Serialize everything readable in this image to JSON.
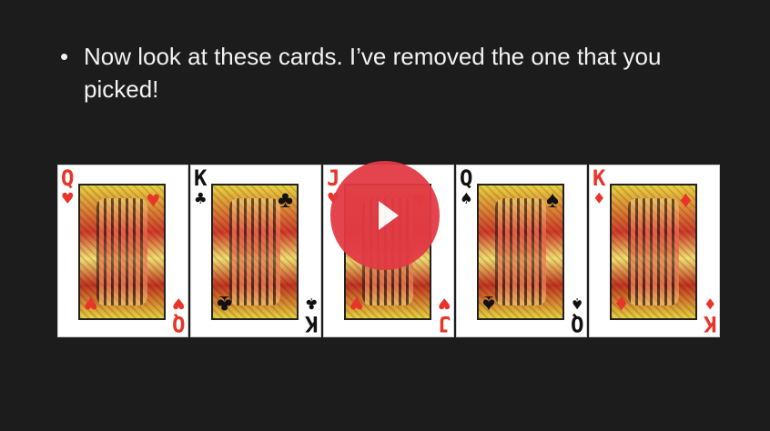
{
  "slide": {
    "bullet": "•",
    "text": "Now look at these cards. I’ve removed the one that you picked!"
  },
  "cards": [
    {
      "rank": "Q",
      "suit": "♥",
      "color": "#e8342a",
      "name": "card-queen-of-hearts"
    },
    {
      "rank": "K",
      "suit": "♣",
      "color": "#111111",
      "name": "card-king-of-clubs"
    },
    {
      "rank": "J",
      "suit": "♥",
      "color": "#e8342a",
      "name": "card-jack-of-hearts"
    },
    {
      "rank": "Q",
      "suit": "♠",
      "color": "#111111",
      "name": "card-queen-of-spades"
    },
    {
      "rank": "K",
      "suit": "♦",
      "color": "#e8342a",
      "name": "card-king-of-diamonds"
    }
  ],
  "video": {
    "play_icon": "play-icon",
    "accent": "#e23a45"
  }
}
